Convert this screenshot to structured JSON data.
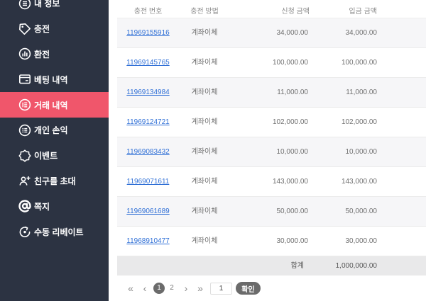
{
  "theme": {
    "sidebar_bg": "#2c3342",
    "active_bg": "#f0566b",
    "link_color": "#2f6fd6",
    "total_row_bg": "#e9e9ea",
    "button_bg": "#6b6b6b"
  },
  "sidebar": {
    "items": [
      {
        "label": "내 정보",
        "icon": "user-info-icon",
        "active": false
      },
      {
        "label": "충전",
        "icon": "deposit-tag-icon",
        "active": false
      },
      {
        "label": "환전",
        "icon": "exchange-chart-icon",
        "active": false
      },
      {
        "label": "베팅 내역",
        "icon": "betting-window-icon",
        "active": false
      },
      {
        "label": "거래 내역",
        "icon": "transaction-list-icon",
        "active": true
      },
      {
        "label": "개인 손익",
        "icon": "profit-loss-icon",
        "active": false
      },
      {
        "label": "이벤트",
        "icon": "event-badge-icon",
        "active": false
      },
      {
        "label": "친구를 초대",
        "icon": "invite-friend-icon",
        "active": false
      },
      {
        "label": "쪽지",
        "icon": "at-message-icon",
        "active": false
      },
      {
        "label": "수동 리베이트",
        "icon": "rebate-icon",
        "active": false
      }
    ]
  },
  "table": {
    "headers": [
      "충전 번호",
      "충전 방법",
      "신청 금액",
      "입금 금액"
    ],
    "rows": [
      {
        "id": "11969155916",
        "method": "계좌이체",
        "requested": "34,000.00",
        "deposited": "34,000.00"
      },
      {
        "id": "11969145765",
        "method": "계좌이체",
        "requested": "100,000.00",
        "deposited": "100,000.00"
      },
      {
        "id": "11969134984",
        "method": "계좌이체",
        "requested": "11,000.00",
        "deposited": "11,000.00"
      },
      {
        "id": "11969124721",
        "method": "계좌이체",
        "requested": "102,000.00",
        "deposited": "102,000.00"
      },
      {
        "id": "11969083432",
        "method": "계좌이체",
        "requested": "10,000.00",
        "deposited": "10,000.00"
      },
      {
        "id": "11969071611",
        "method": "계좌이체",
        "requested": "143,000.00",
        "deposited": "143,000.00"
      },
      {
        "id": "11969061689",
        "method": "계좌이체",
        "requested": "50,000.00",
        "deposited": "50,000.00"
      },
      {
        "id": "11968910477",
        "method": "계좌이체",
        "requested": "30,000.00",
        "deposited": "30,000.00"
      }
    ],
    "total": {
      "label": "합계",
      "amount": "1,000,000.00"
    }
  },
  "pagination": {
    "first": "«",
    "prev": "‹",
    "pages": [
      "1",
      "2"
    ],
    "current": "1",
    "next": "›",
    "last": "»",
    "goto_value": "1",
    "confirm_label": "확인"
  }
}
